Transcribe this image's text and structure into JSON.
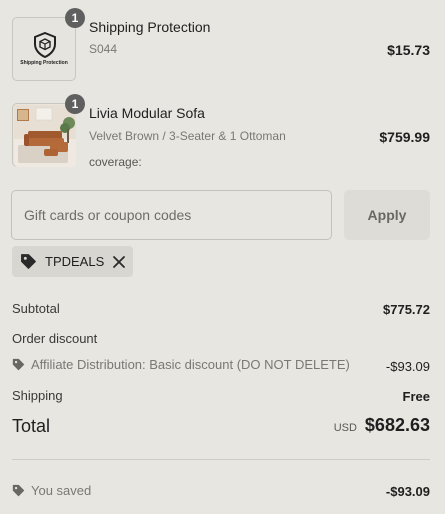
{
  "line_items": [
    {
      "quantity": "1",
      "title": "Shipping Protection",
      "subtitle": "S044",
      "price": "$15.73",
      "thumb_caption": "Shipping Protection",
      "thumb_icon": "shield-package-icon"
    },
    {
      "quantity": "1",
      "title": "Livia Modular Sofa",
      "subtitle": "Velvet Brown / 3-Seater & 1 Ottoman",
      "extra": "coverage:",
      "price": "$759.99",
      "thumb_icon": "sofa-photo"
    }
  ],
  "discount_form": {
    "placeholder": "Gift cards or coupon codes",
    "value": "",
    "apply_label": "Apply"
  },
  "applied_code": {
    "code": "TPDEALS",
    "tag_icon": "tag-icon",
    "remove_icon": "close-icon"
  },
  "summary": {
    "subtotal_label": "Subtotal",
    "subtotal_value": "$775.72",
    "order_discount_label": "Order discount",
    "discount_name": "Affiliate Distribution: Basic discount (DO NOT DELETE)",
    "discount_value": "-$93.09",
    "shipping_label": "Shipping",
    "shipping_value": "Free",
    "total_label": "Total",
    "currency": "USD",
    "total_value": "$682.63",
    "saved_label": "You saved",
    "saved_value": "-$93.09"
  },
  "colors": {
    "background": "#e8e6e1",
    "badge": "#5f5f5f",
    "muted_text": "#7a7873"
  }
}
